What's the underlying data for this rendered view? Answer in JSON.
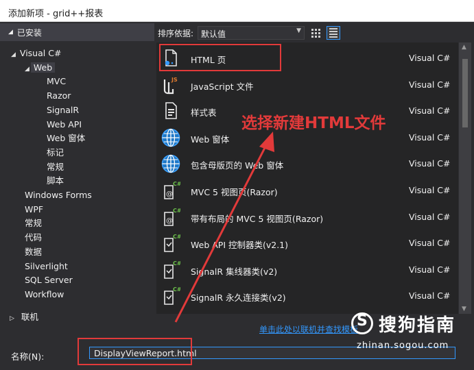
{
  "window": {
    "title": "添加新项 - grid++报表"
  },
  "installed_header": "已安装",
  "sort": {
    "label": "排序依据:",
    "value": "默认值"
  },
  "tree": [
    {
      "label": "Visual C#",
      "level": 1,
      "arrow": "◢"
    },
    {
      "label": "Web",
      "level": 2,
      "arrow": "◢",
      "selected": true
    },
    {
      "label": "MVC",
      "level": 3
    },
    {
      "label": "Razor",
      "level": 3
    },
    {
      "label": "SignalR",
      "level": 3
    },
    {
      "label": "Web API",
      "level": 3
    },
    {
      "label": "Web 窗体",
      "level": 3
    },
    {
      "label": "标记",
      "level": 3
    },
    {
      "label": "常规",
      "level": 3
    },
    {
      "label": "脚本",
      "level": 3
    },
    {
      "label": "Windows Forms",
      "level": 2
    },
    {
      "label": "WPF",
      "level": 2
    },
    {
      "label": "常规",
      "level": 2
    },
    {
      "label": "代码",
      "level": 2
    },
    {
      "label": "数据",
      "level": 2
    },
    {
      "label": "Silverlight",
      "level": 2
    },
    {
      "label": "SQL Server",
      "level": 2
    },
    {
      "label": "Workflow",
      "level": 2
    }
  ],
  "online": "联机",
  "templates": [
    {
      "name": "HTML 页",
      "lang": "Visual C#",
      "icon": "html-page-icon"
    },
    {
      "name": "JavaScript 文件",
      "lang": "Visual C#",
      "icon": "javascript-file-icon"
    },
    {
      "name": "样式表",
      "lang": "Visual C#",
      "icon": "stylesheet-icon"
    },
    {
      "name": "Web 窗体",
      "lang": "Visual C#",
      "icon": "globe-icon"
    },
    {
      "name": "包含母版页的 Web 窗体",
      "lang": "Visual C#",
      "icon": "globe-icon"
    },
    {
      "name": "MVC 5 视图页(Razor)",
      "lang": "Visual C#",
      "icon": "razor-view-icon"
    },
    {
      "name": "带有布局的 MVC 5 视图页(Razor)",
      "lang": "Visual C#",
      "icon": "razor-view-icon"
    },
    {
      "name": "Web API 控制器类(v2.1)",
      "lang": "Visual C#",
      "icon": "csharp-class-icon"
    },
    {
      "name": "SignalR 集线器类(v2)",
      "lang": "Visual C#",
      "icon": "csharp-class-icon"
    },
    {
      "name": "SignalR 永久连接类(v2)",
      "lang": "Visual C#",
      "icon": "csharp-class-icon"
    }
  ],
  "online_link": "单击此处以联机并查找模板",
  "name_field": {
    "label": "名称(N):",
    "value": "DisplayViewReport.html"
  },
  "annotation": {
    "text": "选择新建HTML文件"
  },
  "watermark": {
    "letter": "S",
    "brand": "搜狗指南",
    "domain": "zhinan.sogou.com"
  },
  "colors": {
    "accent": "#3399ff",
    "annotation": "#e23a3a",
    "background": "#2d2d30",
    "list_background": "#252526"
  }
}
